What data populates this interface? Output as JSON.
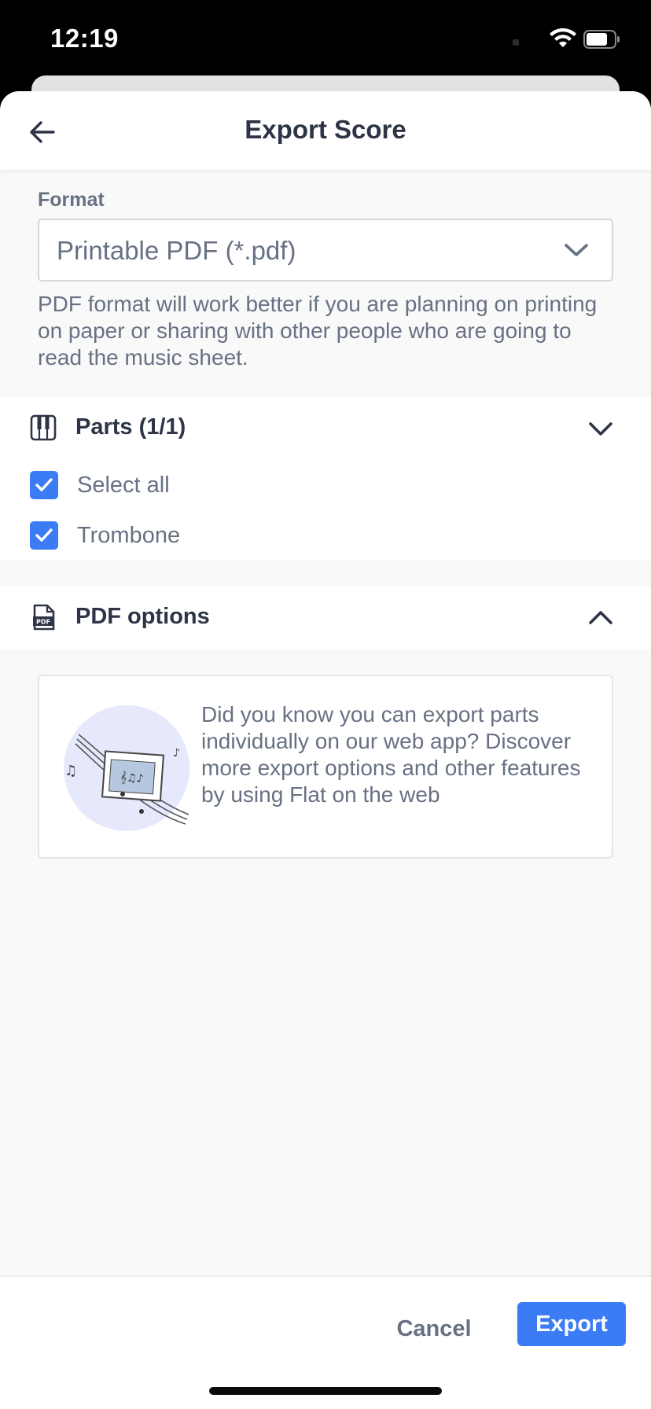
{
  "status_bar": {
    "time": "12:19"
  },
  "header": {
    "title": "Export Score"
  },
  "format": {
    "label": "Format",
    "selected_value": "Printable PDF (*.pdf)",
    "help_text": "PDF format will work better if you are planning on printing on paper or sharing with other people who are going to read the music sheet."
  },
  "parts": {
    "title": "Parts (1/1)",
    "items": [
      {
        "label": "Select all",
        "checked": true
      },
      {
        "label": "Trombone",
        "checked": true
      }
    ]
  },
  "pdf_options": {
    "title": "PDF options"
  },
  "promo": {
    "text": "Did you know you can export parts individually on our web app? Discover more export options and other features by using Flat on the web"
  },
  "footer": {
    "cancel_label": "Cancel",
    "export_label": "Export"
  },
  "colors": {
    "accent": "#3b7cf5",
    "text_primary": "#2d3446",
    "text_secondary": "#677183"
  }
}
